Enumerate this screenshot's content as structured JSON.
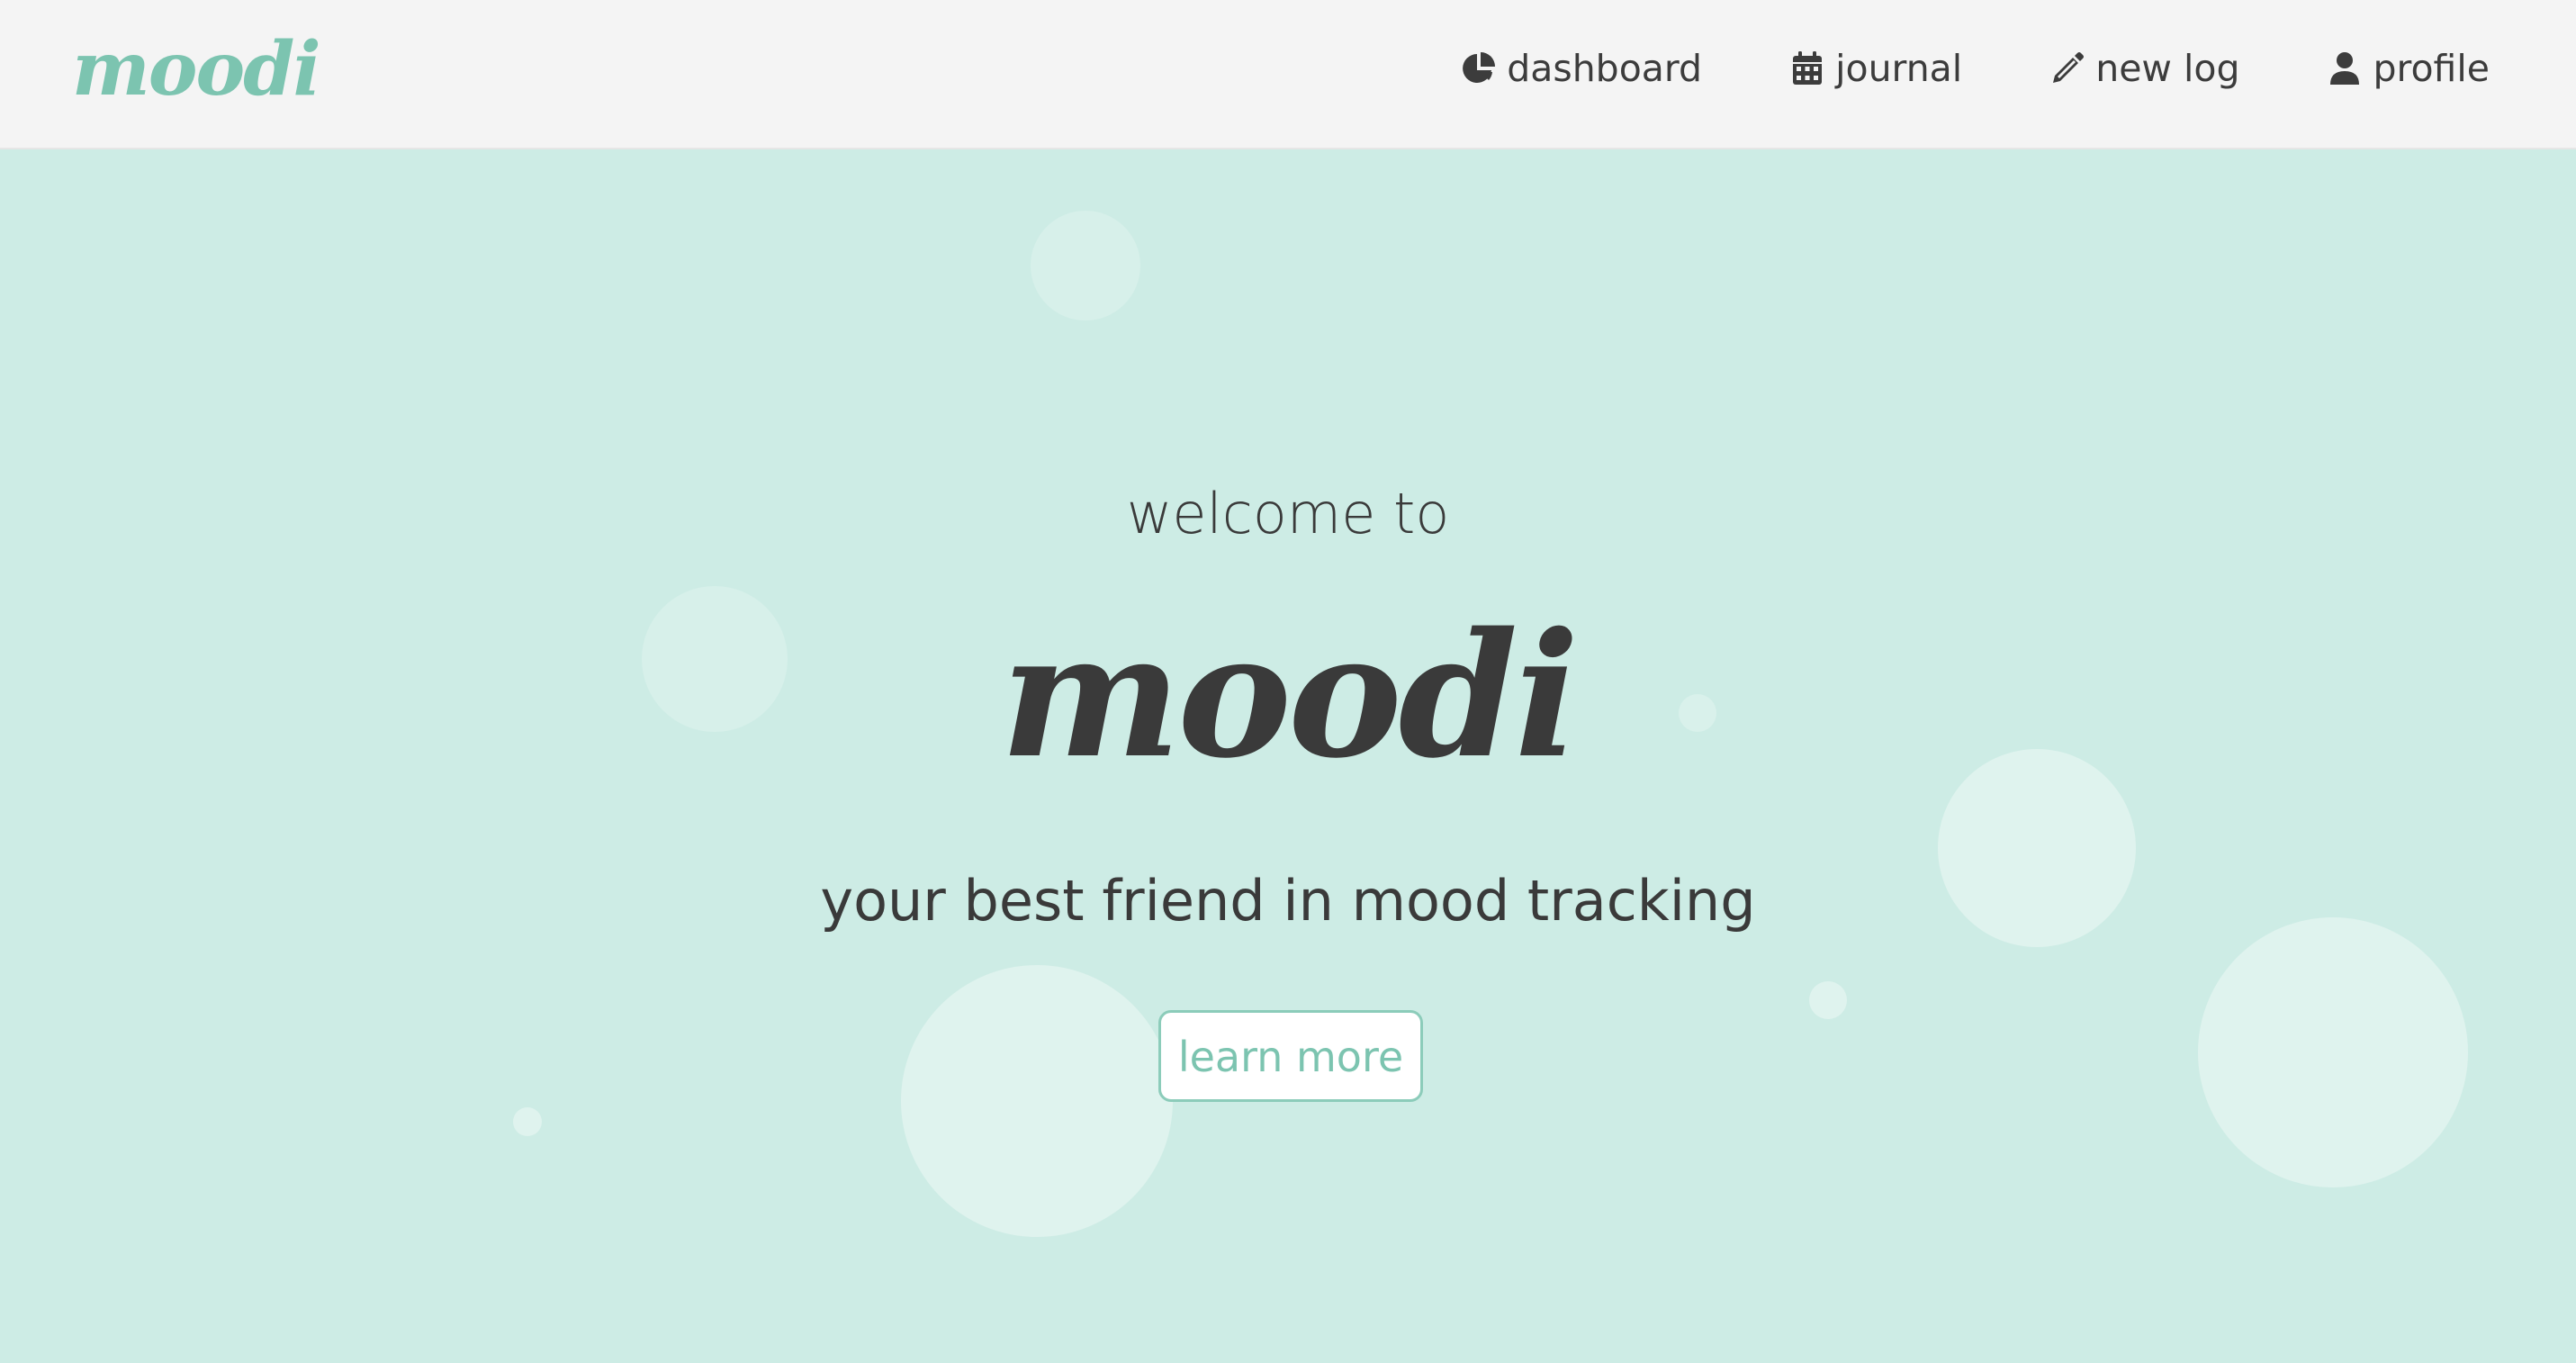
{
  "navbar": {
    "brand": "moodi",
    "items": [
      {
        "label": "dashboard",
        "icon": "pie-chart-icon"
      },
      {
        "label": "journal",
        "icon": "calendar-icon"
      },
      {
        "label": "new log",
        "icon": "pencil-icon"
      },
      {
        "label": "profile",
        "icon": "user-icon"
      }
    ]
  },
  "hero": {
    "welcome": "welcome to",
    "title": "moodi",
    "tagline": "your best friend in mood tracking",
    "cta_label": "learn more"
  },
  "colors": {
    "brand": "#7cc4b0",
    "hero_background": "#cdece5",
    "navbar_background": "#f4f4f4",
    "text": "#3a3a3a"
  }
}
